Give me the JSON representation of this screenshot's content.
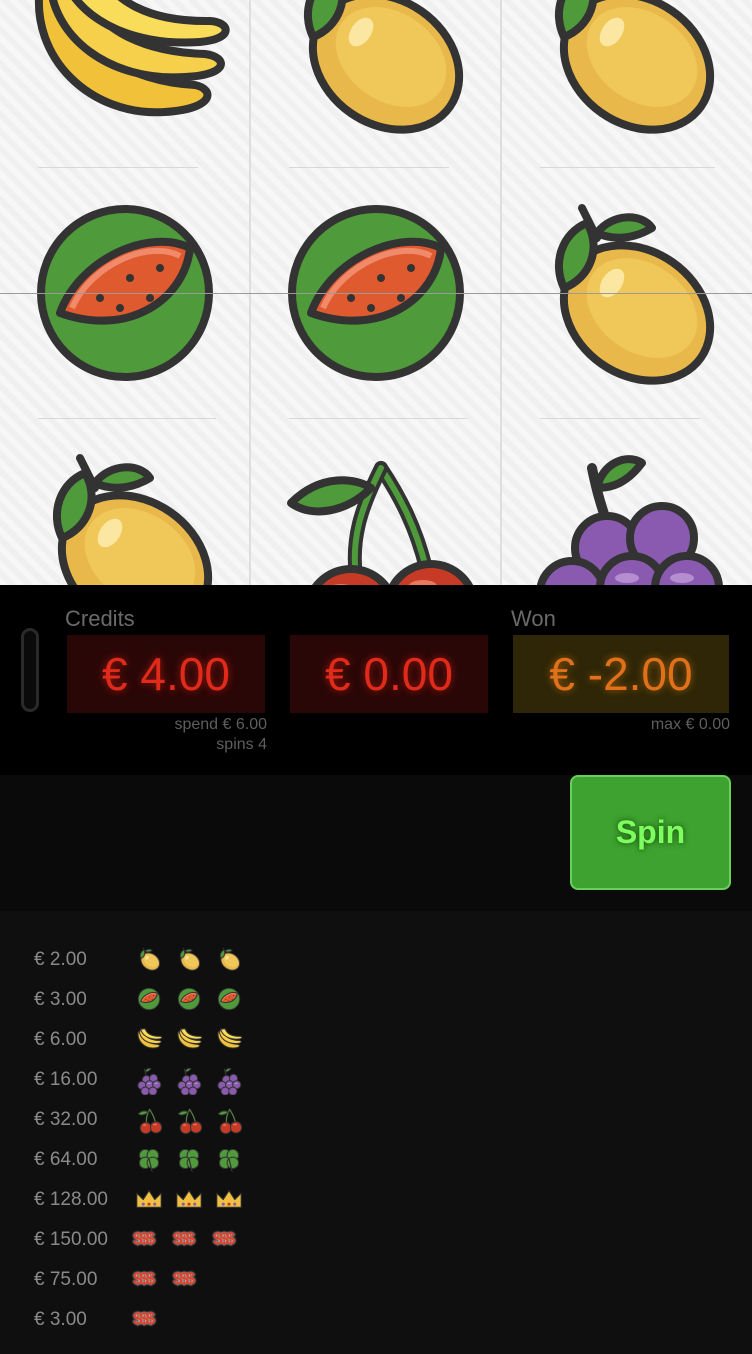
{
  "reels": [
    [
      "banana",
      "watermelon",
      "lemon"
    ],
    [
      "lemon",
      "watermelon",
      "cherry"
    ],
    [
      "lemon",
      "lemon",
      "grapes"
    ]
  ],
  "credits": {
    "label": "Credits",
    "value": "€ 4.00",
    "spend": "spend € 6.00",
    "spins": "spins 4"
  },
  "bet": {
    "value": "€ 0.00"
  },
  "won": {
    "label": "Won",
    "value": "€ -2.00",
    "max": "max € 0.00"
  },
  "spin_button": {
    "label": "Spin"
  },
  "paytable": [
    {
      "amount": "€ 2.00",
      "symbol": "lemon-icon",
      "count": 3
    },
    {
      "amount": "€ 3.00",
      "symbol": "watermelon-icon",
      "count": 3
    },
    {
      "amount": "€ 6.00",
      "symbol": "banana-icon",
      "count": 3
    },
    {
      "amount": "€ 16.00",
      "symbol": "grapes-icon",
      "count": 3
    },
    {
      "amount": "€ 32.00",
      "symbol": "cherry-icon",
      "count": 3
    },
    {
      "amount": "€ 64.00",
      "symbol": "clover-icon",
      "count": 3
    },
    {
      "amount": "€ 128.00",
      "symbol": "crown-icon",
      "count": 3
    },
    {
      "amount": "€ 150.00",
      "symbol": "dollar-icon",
      "count": 3
    },
    {
      "amount": "€ 75.00",
      "symbol": "dollar-icon",
      "count": 2
    },
    {
      "amount": "€ 3.00",
      "symbol": "dollar-icon",
      "count": 1
    }
  ],
  "dollar_text": "$$$",
  "colors": {
    "credit_display": "#e02a1a",
    "won_display": "#e0701a",
    "spin_button": "#3da22f",
    "spin_text": "#7dff5e"
  }
}
